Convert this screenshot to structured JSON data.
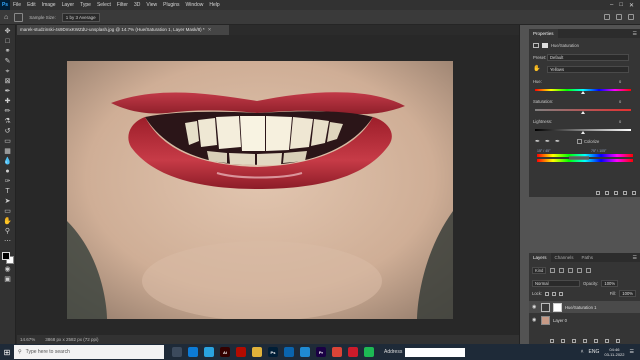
{
  "app": {
    "logo": "Ps",
    "menu": [
      "File",
      "Edit",
      "Image",
      "Layer",
      "Type",
      "Select",
      "Filter",
      "3D",
      "View",
      "Plugins",
      "Window",
      "Help"
    ]
  },
  "options": {
    "sample_size_label": "Sample Size:",
    "sample_size_value": "1 by 3 Average"
  },
  "document": {
    "tab_title": "marek-studzinski-4s9DmxKWZdU-unsplash.jpg @ 14.7% (Hue/Saturation 1, Layer Mask/8) *",
    "zoom": "14.67%",
    "doc_info": "3868 px x 2582 px (72 ppi)"
  },
  "properties": {
    "tab": "Properties",
    "adjustment_name": "Hue/Saturation",
    "preset_label": "Preset:",
    "preset_value": "Default",
    "channel_value": "Yellows",
    "hue_label": "Hue:",
    "hue_value": "0",
    "saturation_label": "Saturation:",
    "saturation_value": "0",
    "lightness_label": "Lightness:",
    "lightness_value": "0",
    "colorize_label": "Colorize",
    "range_left": "15° / 45°",
    "range_right": "75° \\ 105°"
  },
  "layers": {
    "tabs": [
      "Layers",
      "Channels",
      "Paths"
    ],
    "kind_label": "Kind",
    "blend_mode": "Normal",
    "opacity_label": "Opacity:",
    "opacity_value": "100%",
    "lock_label": "Lock:",
    "fill_label": "Fill:",
    "fill_value": "100%",
    "items": [
      {
        "name": "Hue/Saturation 1",
        "selected": true
      },
      {
        "name": "Layer 0",
        "selected": false
      }
    ]
  },
  "taskbar": {
    "search_placeholder": "Type here to search",
    "address_label": "Address",
    "language": "ENG",
    "time": "04:46",
    "date": "03-11-2022",
    "apps": [
      {
        "name": "task-view",
        "color": "#3c4a5c"
      },
      {
        "name": "edge",
        "color": "#0c7bd6"
      },
      {
        "name": "telegram",
        "color": "#2aa3df"
      },
      {
        "name": "illustrator",
        "color": "#330000",
        "text": "Ai"
      },
      {
        "name": "acrobat",
        "color": "#b30b00"
      },
      {
        "name": "file-explorer",
        "color": "#e0b23a"
      },
      {
        "name": "photoshop",
        "color": "#001e36",
        "text": "Ps"
      },
      {
        "name": "mail",
        "color": "#0a64ad"
      },
      {
        "name": "vscode",
        "color": "#1f8ad2"
      },
      {
        "name": "premiere",
        "color": "#1a0044",
        "text": "Pr"
      },
      {
        "name": "chrome",
        "color": "#db4437"
      },
      {
        "name": "opera",
        "color": "#cc1b2b"
      },
      {
        "name": "spotify",
        "color": "#1db954"
      }
    ]
  }
}
